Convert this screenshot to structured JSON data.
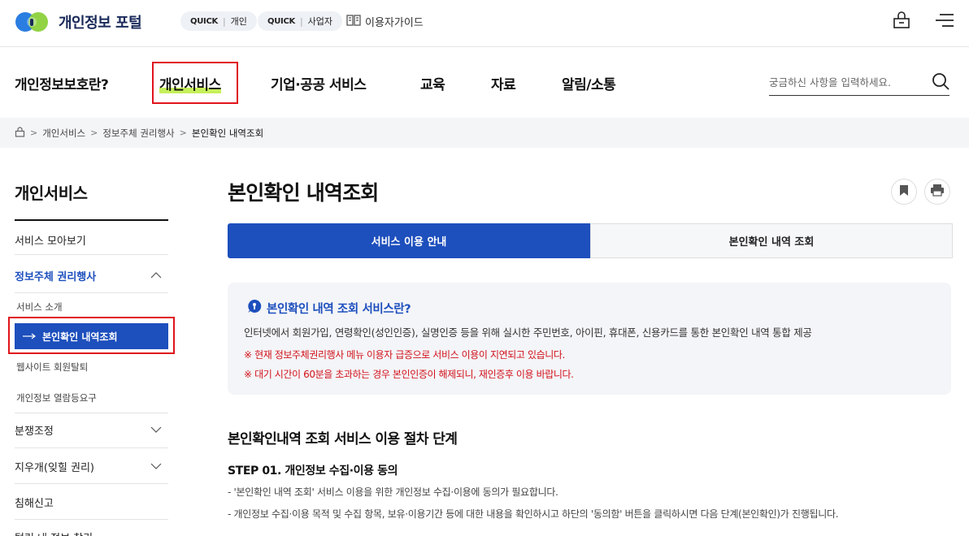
{
  "header": {
    "logo_text": "개인정보 포털",
    "quick_personal": {
      "badge": "QUICK",
      "label": "개인"
    },
    "quick_business": {
      "badge": "QUICK",
      "label": "사업자"
    },
    "guide_label": "이용자가이드"
  },
  "gnb": {
    "items": [
      "개인정보보호란?",
      "개인서비스",
      "기업·공공 서비스",
      "교육",
      "자료",
      "알림/소통"
    ],
    "active_index": 1,
    "search_placeholder": "궁금하신 사항을 입력하세요."
  },
  "breadcrumb": [
    "개인서비스",
    "정보주체 권리행사",
    "본인확인 내역조회"
  ],
  "sidebar": {
    "title": "개인서비스",
    "items": [
      {
        "label": "서비스 모아보기"
      },
      {
        "label": "정보주체 권리행사",
        "expanded": true
      },
      {
        "label": "분쟁조정"
      },
      {
        "label": "지우개(잊힐 권리)"
      },
      {
        "label": "침해신고"
      },
      {
        "label": "털린 내 정보 찾기"
      }
    ],
    "subitems": [
      "서비스 소개",
      "본인확인 내역조회",
      "웹사이트 회원탈퇴",
      "개인정보 열람등요구"
    ],
    "active_sub_index": 1
  },
  "main": {
    "title": "본인확인 내역조회",
    "tabs": [
      "서비스 이용 안내",
      "본인확인 내역 조회"
    ],
    "active_tab": 0,
    "info": {
      "heading": "본인확인 내역 조회 서비스란?",
      "description": "인터넷에서 회원가입, 연령확인(성인인증), 실명인증 등을 위해 실시한 주민번호, 아이핀, 휴대폰, 신용카드를 통한 본인확인 내역 통합 제공",
      "warnings": [
        "※ 현재 정보주체권리행사 메뉴 이용자 급증으로 서비스 이용이 지연되고 있습니다.",
        "※ 대기 시간이 60분을 초과하는 경우 본인인증이 해제되니, 재인증후 이용 바랍니다."
      ]
    },
    "section_title": "본인확인내역 조회 서비스 이용 절차 단계",
    "step1": {
      "title": "STEP 01. 개인정보 수집·이용 동의",
      "lines": [
        "- '본인확인 내역 조회' 서비스 이용을 위한 개인정보 수집·이용에 동의가 필요합니다.",
        "- 개인정보 수집·이용 목적 및 수집 항목, 보유·이용기간 등에 대한 내용을 확인하시고 하단의 '동의함' 버튼을 클릭하시면 다음 단계(본인확인)가 진행됩니다."
      ]
    }
  },
  "colors": {
    "primary": "#1d4fbd",
    "highlight": "#c6f05a",
    "warning": "#d2121b",
    "annotation": "#e0141c"
  }
}
